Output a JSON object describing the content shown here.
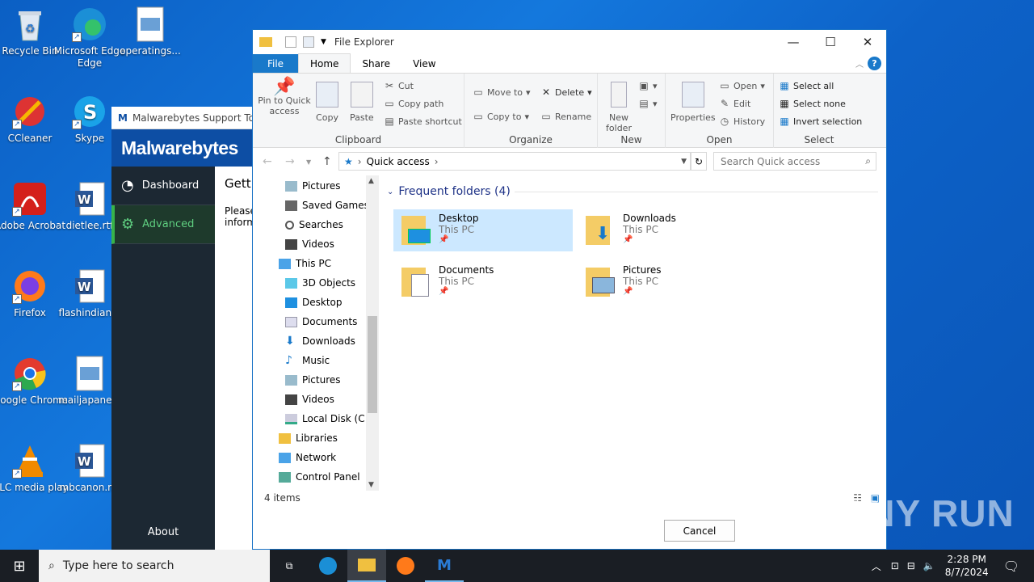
{
  "desktop": {
    "icons": [
      {
        "label": "Recycle Bin"
      },
      {
        "label": "Microsoft Edge"
      },
      {
        "label": "operatings..."
      },
      {
        "label": "CCleaner"
      },
      {
        "label": "Skype"
      },
      {
        "label": "Adobe Acrobat"
      },
      {
        "label": "dietlee.rtf"
      },
      {
        "label": "Firefox"
      },
      {
        "label": "flashindian..."
      },
      {
        "label": "Google Chrome"
      },
      {
        "label": "mailjapane..."
      },
      {
        "label": "VLC media player"
      },
      {
        "label": "mbcanon.r..."
      }
    ]
  },
  "malwarebytes": {
    "title": "Malwarebytes Support Tool",
    "logo": "Malwarebytes",
    "nav": [
      "Dashboard",
      "Advanced"
    ],
    "about": "About",
    "heading": "Getti",
    "body_line1": "Please",
    "body_line2": "inform"
  },
  "explorer": {
    "title": "File Explorer",
    "tabs": [
      "File",
      "Home",
      "Share",
      "View"
    ],
    "ribbon": {
      "clipboard": {
        "label": "Clipboard",
        "pin": "Pin to Quick access",
        "copy": "Copy",
        "paste": "Paste",
        "cut": "Cut",
        "copy_path": "Copy path",
        "paste_shortcut": "Paste shortcut"
      },
      "organize": {
        "label": "Organize",
        "move_to": "Move to",
        "copy_to": "Copy to",
        "delete": "Delete",
        "rename": "Rename"
      },
      "new": {
        "label": "New",
        "new_folder": "New folder"
      },
      "open": {
        "label": "Open",
        "properties": "Properties",
        "open": "Open",
        "edit": "Edit",
        "history": "History"
      },
      "select": {
        "label": "Select",
        "select_all": "Select all",
        "select_none": "Select none",
        "invert": "Invert selection"
      }
    },
    "address": "Quick access",
    "search_placeholder": "Search Quick access",
    "nav_items": [
      "Pictures",
      "Saved Games",
      "Searches",
      "Videos",
      "This PC",
      "3D Objects",
      "Desktop",
      "Documents",
      "Downloads",
      "Music",
      "Pictures",
      "Videos",
      "Local Disk (C:)",
      "Libraries",
      "Network",
      "Control Panel"
    ],
    "group_header": "Frequent folders (4)",
    "folders": [
      {
        "name": "Desktop",
        "location": "This PC"
      },
      {
        "name": "Downloads",
        "location": "This PC"
      },
      {
        "name": "Documents",
        "location": "This PC"
      },
      {
        "name": "Pictures",
        "location": "This PC"
      }
    ],
    "status": "4 items",
    "cancel": "Cancel"
  },
  "taskbar": {
    "search_placeholder": "Type here to search",
    "time": "2:28 PM",
    "date": "8/7/2024"
  },
  "watermark": "ANY RUN"
}
